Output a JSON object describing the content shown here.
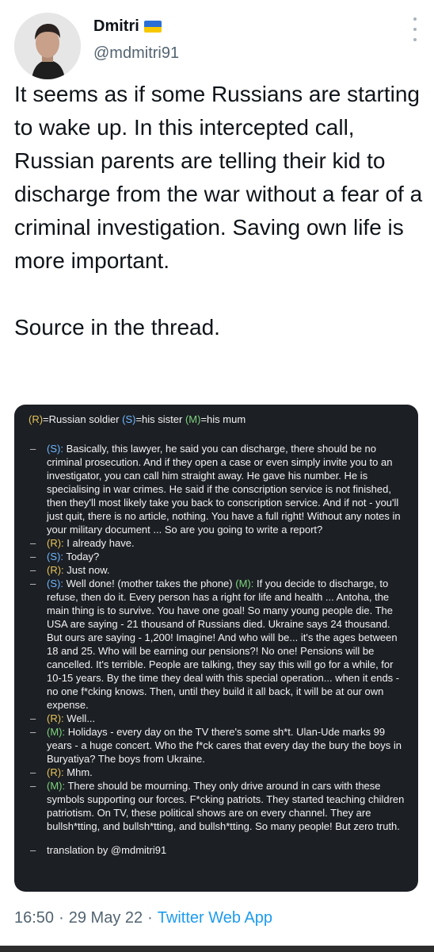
{
  "author": {
    "name": "Dmitri",
    "handle": "@mdmitri91",
    "flag": "ukraine-flag"
  },
  "tweet": {
    "text": "It seems as if some Russians are starting to wake up. In this intercepted call, Russian parents are telling their kid to discharge from the war without a fear of a criminal investigation. Saving own life is more important.",
    "source": "Source in the thread."
  },
  "transcript": {
    "legend": {
      "r_tag": "(R)",
      "r_text": "=Russian soldier ",
      "s_tag": "(S)",
      "s_text": "=his sister ",
      "m_tag": "(M)",
      "m_text": "=his mum"
    },
    "lines": [
      {
        "tag": "(S):",
        "color": "#6fb8ff",
        "text": " Basically, this lawyer, he said you can discharge, there should be no criminal prosecution. And if they open a case or even simply invite you to an investigator, you can call him straight away. He gave his number. He is specialising in war crimes. He said if the conscription service is not finished, then they'll most likely take you back to conscription service. And if not - you'll just quit, there is no article, nothing. You have a full right! Without any notes in your military document ... So are you going to write a report?"
      },
      {
        "tag": "(R):",
        "color": "#e7c55b",
        "text": " I already have."
      },
      {
        "tag": "(S):",
        "color": "#6fb8ff",
        "text": " Today?"
      },
      {
        "tag": "(R):",
        "color": "#e7c55b",
        "text": " Just now."
      },
      {
        "tag": "(S):",
        "color": "#6fb8ff",
        "text": " Well done! (mother takes the phone) ",
        "tag2": "(M):",
        "color2": "#7ed47e",
        "text2": " If you decide to discharge, to refuse, then do it. Every person has a right for life and health ... Antoha, the main thing is to survive. You have one goal! So many young people die. The USA are saying - 21 thousand of Russians died. Ukraine says 24 thousand. But ours are saying - 1,200! Imagine! And who will be... it's the ages between 18 and 25. Who will be earning our pensions?! No one! Pensions will be cancelled. It's terrible. People are talking, they say this will go for a while, for 10-15 years. By the time they deal with this special operation... when it ends - no one f*cking knows. Then, until they build it all back, it will be at our own expense."
      },
      {
        "tag": "(R):",
        "color": "#e7c55b",
        "text": " Well..."
      },
      {
        "tag": "(M):",
        "color": "#7ed47e",
        "text": " Holidays - every day on the TV there's some sh*t. Ulan-Ude marks 99 years - a huge concert. Who the f*ck cares that every day the bury the boys in Buryatiya? The boys from Ukraine."
      },
      {
        "tag": "(R):",
        "color": "#e7c55b",
        "text": " Mhm."
      },
      {
        "tag": "(M):",
        "color": "#7ed47e",
        "text": " There should be mourning. They only drive around in cars with these symbols supporting our forces. F*cking patriots. They started teaching children patriotism. On TV, these political shows are on every channel. They are bullsh*tting, and bullsh*tting, and bullsh*tting. So many people! But zero truth."
      }
    ],
    "credit": "translation by @mdmitri91"
  },
  "meta": {
    "time": "16:50",
    "sep1": "·",
    "date": "29 May 22",
    "sep2": "·",
    "client": "Twitter Web App"
  }
}
